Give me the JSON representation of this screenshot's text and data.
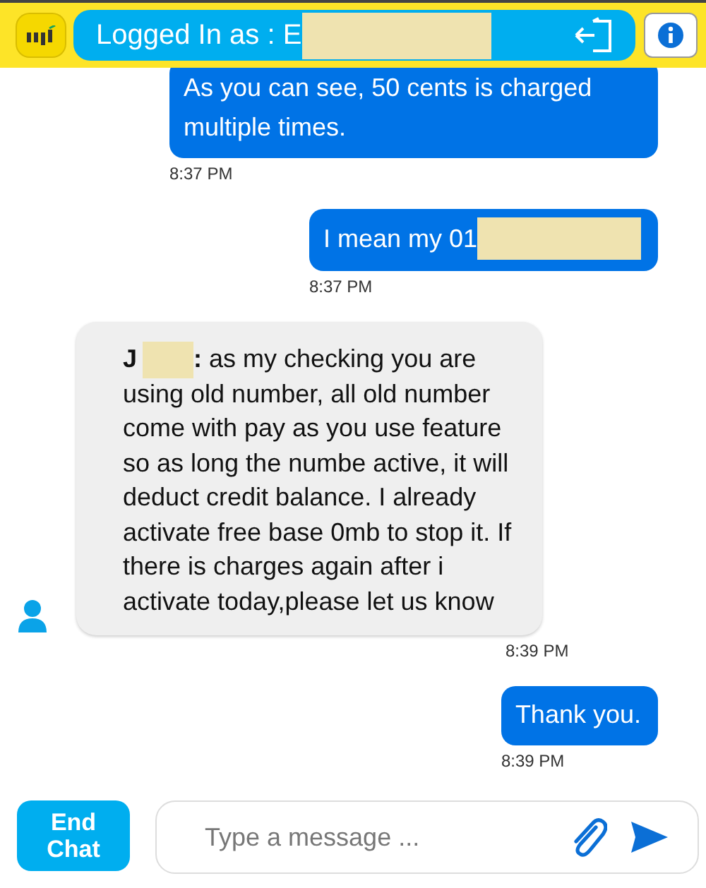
{
  "header": {
    "logged_in_label": "Logged In as : E",
    "redacted": true
  },
  "messages": [
    {
      "kind": "outgoing",
      "text": "As you can see, 50 cents is charged multiple times.",
      "time": "8:37 PM"
    },
    {
      "kind": "outgoing",
      "text": "I mean my 01",
      "redacted": true,
      "time": "8:37 PM"
    },
    {
      "kind": "incoming",
      "sender": "J",
      "redacted": true,
      "text": "**:** as my checking you are using old number, all old number come with pay as you use feature so as long the numbe active, it will deduct credit balance. I already activate free base 0mb to stop it. If there is charges again after i activate today,please let us know",
      "time": "8:39 PM"
    },
    {
      "kind": "outgoing",
      "text": "Thank you.",
      "time": "8:39 PM"
    }
  ],
  "composer": {
    "end_button": "End Chat",
    "placeholder": "Type a message ..."
  }
}
